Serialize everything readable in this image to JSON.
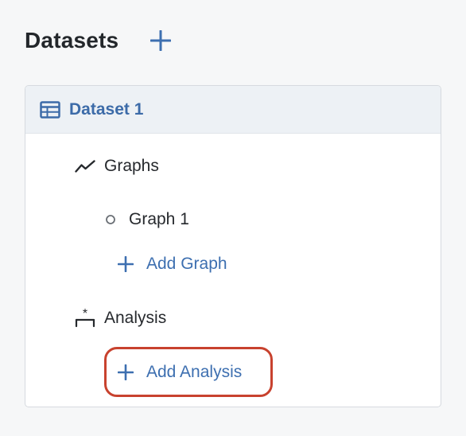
{
  "header": {
    "title": "Datasets",
    "add_icon": "plus-icon"
  },
  "dataset": {
    "name": "Dataset 1",
    "icon": "table-icon",
    "sections": {
      "graphs": {
        "label": "Graphs",
        "icon": "trend-line-icon",
        "items": [
          {
            "label": "Graph 1",
            "icon": "circle-bullet-icon"
          }
        ],
        "add_label": "Add Graph"
      },
      "analysis": {
        "label": "Analysis",
        "icon": "analysis-icon",
        "add_label": "Add Analysis"
      }
    }
  },
  "colors": {
    "accent": "#3d6fb0",
    "highlight": "#c8422e",
    "text": "#26292d"
  }
}
